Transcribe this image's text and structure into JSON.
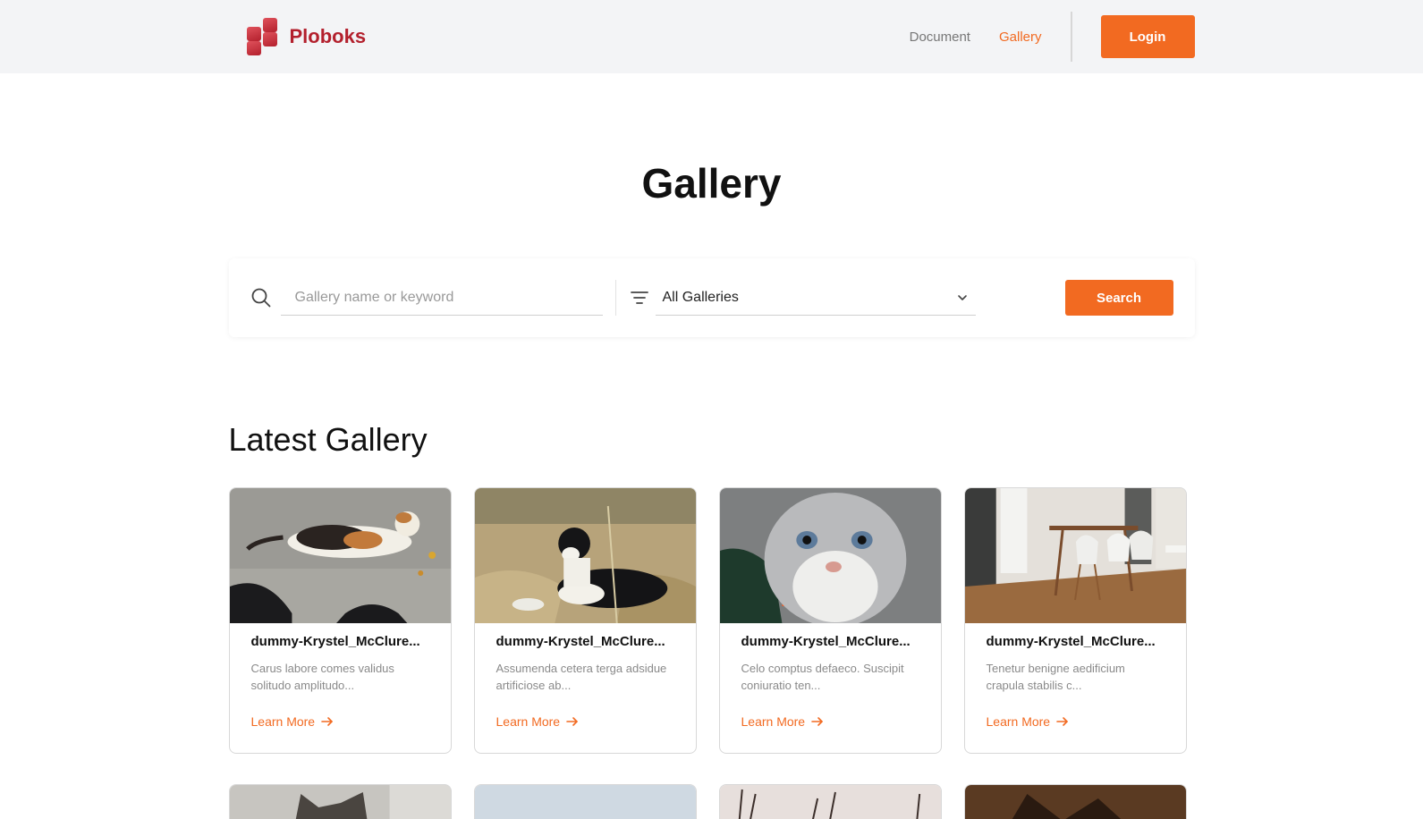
{
  "brand": {
    "name": "Ploboks"
  },
  "nav": {
    "items": [
      {
        "label": "Document",
        "active": false
      },
      {
        "label": "Gallery",
        "active": true
      }
    ],
    "login_label": "Login"
  },
  "page": {
    "title": "Gallery"
  },
  "search": {
    "placeholder": "Gallery name or keyword",
    "value": "",
    "filter_selected": "All Galleries",
    "button_label": "Search"
  },
  "latest": {
    "title": "Latest Gallery",
    "cards": [
      {
        "title": "dummy-Krystel_McClure...",
        "desc": "Carus labore comes validus solitudo amplitudo...",
        "link": "Learn More"
      },
      {
        "title": "dummy-Krystel_McClure...",
        "desc": "Assumenda cetera terga adsidue artificiose ab...",
        "link": "Learn More"
      },
      {
        "title": "dummy-Krystel_McClure...",
        "desc": "Celo comptus defaeco. Suscipit coniuratio ten...",
        "link": "Learn More"
      },
      {
        "title": "dummy-Krystel_McClure...",
        "desc": "Tenetur benigne aedificium crapula stabilis c...",
        "link": "Learn More"
      }
    ]
  },
  "colors": {
    "accent": "#f26a21",
    "brand": "#b3202d",
    "header_bg": "#f3f4f6"
  }
}
